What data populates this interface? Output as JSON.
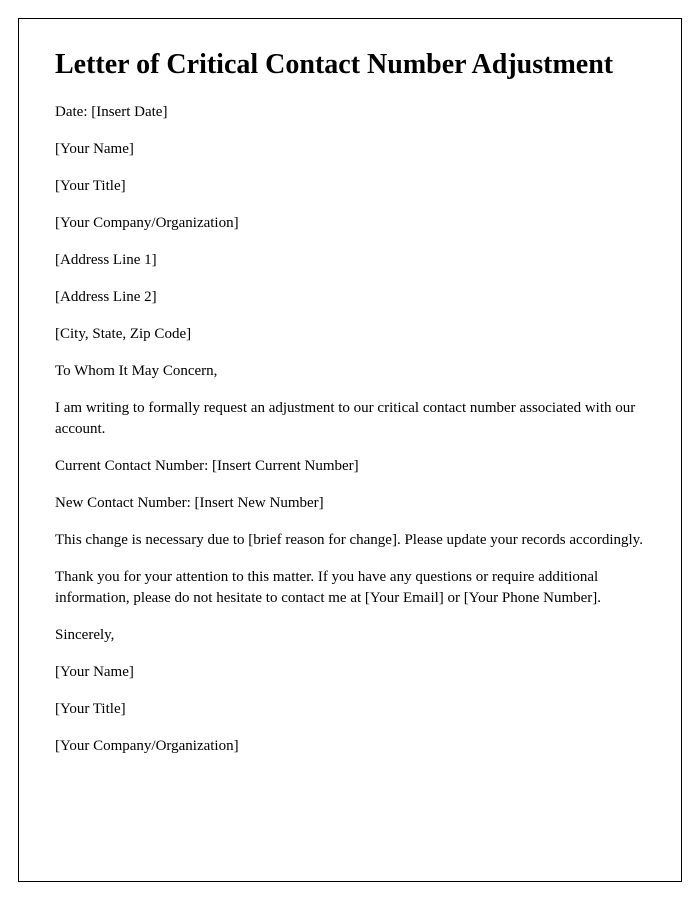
{
  "title": "Letter of Critical Contact Number Adjustment",
  "lines": {
    "date": "Date: [Insert Date]",
    "your_name": "[Your Name]",
    "your_title": "[Your Title]",
    "your_company": "[Your Company/Organization]",
    "address1": "[Address Line 1]",
    "address2": "[Address Line 2]",
    "city_state_zip": "[City, State, Zip Code]",
    "salutation": "To Whom It May Concern,",
    "intro": "I am writing to formally request an adjustment to our critical contact number associated with our account.",
    "current_number": "Current Contact Number: [Insert Current Number]",
    "new_number": "New Contact Number: [Insert New Number]",
    "reason": "This change is necessary due to [brief reason for change]. Please update your records accordingly.",
    "thanks": "Thank you for your attention to this matter. If you have any questions or require additional information, please do not hesitate to contact me at [Your Email] or [Your Phone Number].",
    "closing": "Sincerely,",
    "sig_name": "[Your Name]",
    "sig_title": "[Your Title]",
    "sig_company": "[Your Company/Organization]"
  }
}
